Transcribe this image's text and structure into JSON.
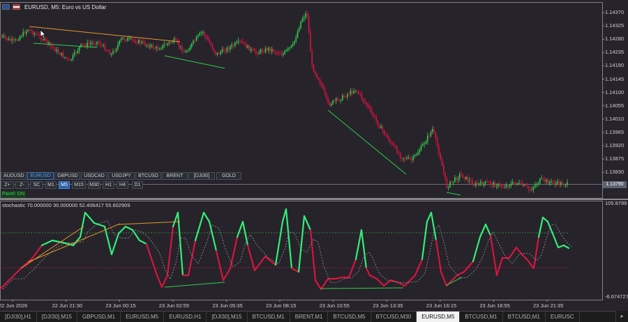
{
  "window": {
    "title": "EURUSD, M5:  Euro vs US Dollar",
    "symbol": "EURUSD",
    "timeframe": "M5",
    "description": "Euro vs US Dollar",
    "bg_color": "#26232b"
  },
  "price_axis": {
    "labels": [
      "1.14370",
      "1.14325",
      "1.14280",
      "1.14235",
      "1.14190",
      "1.14145",
      "1.14100",
      "1.14055",
      "1.14010",
      "1.13965",
      "1.13920",
      "1.13875",
      "1.13830"
    ],
    "current_price": "1.13790"
  },
  "oscillator": {
    "title": "stochastic  70.000000 30.000000 52.406417 55.602909",
    "axis_top": "105.8799",
    "axis_bottom": "-6.674727",
    "levels": [
      70,
      30
    ],
    "up_color": "#33ee77",
    "down_color": "#d8143f"
  },
  "time_axis": {
    "labels": [
      "22 Jun 2026",
      "22 Jun 21:30",
      "23 Jun 00:15",
      "23 Jun 02:55",
      "23 Jun 05:35",
      "23 Jun 08:15",
      "23 Jun 10:55",
      "23 Jun 13:35",
      "23 Jun 16:15",
      "23 Jun 18:55",
      "23 Jun 21:35"
    ]
  },
  "symbol_buttons": [
    {
      "label": "AUDUSD",
      "active": false
    },
    {
      "label": "EURUSD",
      "active": true
    },
    {
      "label": "GBPUSD",
      "active": false
    },
    {
      "label": "USDCAD",
      "active": false
    },
    {
      "label": "USDJPY",
      "active": false
    },
    {
      "label": "BTCUSD",
      "active": false
    },
    {
      "label": "BRENT",
      "active": false
    },
    {
      "label": "[DJI30]",
      "active": false
    },
    {
      "label": "GOLD",
      "active": false
    }
  ],
  "tool_buttons": [
    {
      "label": "Z+",
      "active": false
    },
    {
      "label": "Z-",
      "active": false
    },
    {
      "label": "SC",
      "active": false
    },
    {
      "label": "M1",
      "active": false
    },
    {
      "label": "M5",
      "active": true
    },
    {
      "label": "M15",
      "active": false
    },
    {
      "label": "M30",
      "active": false
    },
    {
      "label": "H1",
      "active": false
    },
    {
      "label": "H4",
      "active": false
    },
    {
      "label": "D1",
      "active": false
    }
  ],
  "panel_status": "Panel: ON",
  "tabs": [
    {
      "label": "[DJI30],H1",
      "active": false
    },
    {
      "label": "[DJI30],M15",
      "active": false
    },
    {
      "label": "GBPUSD,M1",
      "active": false
    },
    {
      "label": "EURUSD,M5",
      "active": false
    },
    {
      "label": "EURUSD,H1",
      "active": false
    },
    {
      "label": "[DJI30],M15",
      "active": false
    },
    {
      "label": "BTCUSD,M1",
      "active": false
    },
    {
      "label": "BRENT,M1",
      "active": false
    },
    {
      "label": "BTCUSD,M5",
      "active": false
    },
    {
      "label": "BTCUSD,M30",
      "active": false
    },
    {
      "label": "EURUSD,M5",
      "active": true
    },
    {
      "label": "BTCUSD,M1",
      "active": false
    },
    {
      "label": "BTCUSD,M1",
      "active": false
    },
    {
      "label": "EURUSC",
      "active": false
    }
  ],
  "tab_scroll_icon": "right-arrow-icon",
  "colors": {
    "bull_candle": "#2fcf4a",
    "bear_candle": "#d8143f",
    "trend_up": "#e8962a",
    "trend_down": "#2fcf4a",
    "grid_line": "#8a8a8a"
  }
}
